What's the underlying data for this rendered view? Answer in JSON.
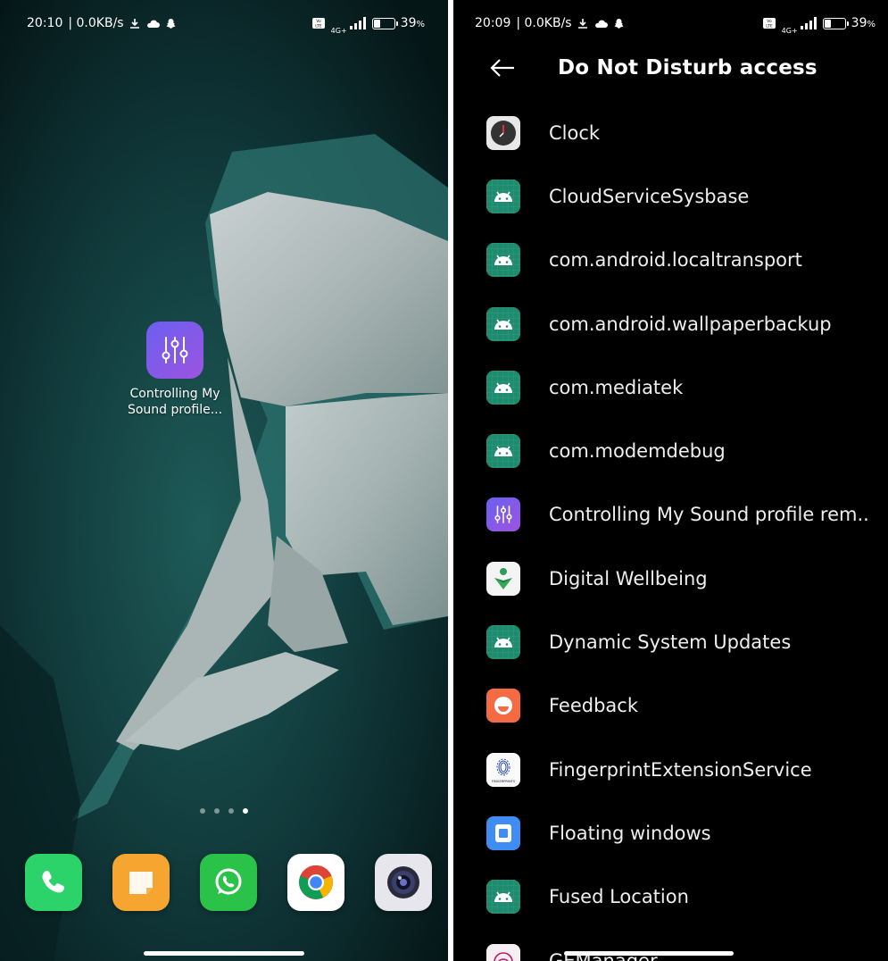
{
  "left_screen": {
    "status_bar": {
      "time": "20:10",
      "speed": "| 0.0KB/s",
      "network": "4G+",
      "battery": "39",
      "battery_unit": "%"
    },
    "home_app": {
      "label_line1": "Controlling My",
      "label_line2": "Sound profile...",
      "icon": "sliders-icon"
    },
    "page_indicator": {
      "pages": 4,
      "active": 4
    },
    "dock": [
      {
        "name": "phone",
        "icon": "phone-icon",
        "color": "#2bd36a"
      },
      {
        "name": "messages",
        "icon": "message-icon",
        "color": "#f7a531"
      },
      {
        "name": "whatsapp",
        "icon": "whatsapp-icon",
        "color": "#2bc24a"
      },
      {
        "name": "chrome",
        "icon": "chrome-icon",
        "color": "#ffffff"
      },
      {
        "name": "camera",
        "icon": "camera-icon",
        "color": "#e6e6ec"
      }
    ]
  },
  "right_screen": {
    "status_bar": {
      "time": "20:09",
      "speed": "| 0.0KB/s",
      "network": "4G+",
      "battery": "39",
      "battery_unit": "%"
    },
    "header": {
      "title": "Do Not Disturb access",
      "back_icon": "back-arrow-icon"
    },
    "apps": [
      {
        "label": "Clock",
        "icon": "clock-icon"
      },
      {
        "label": "CloudServiceSysbase",
        "icon": "android-icon"
      },
      {
        "label": "com.android.localtransport",
        "icon": "android-icon"
      },
      {
        "label": "com.android.wallpaperbackup",
        "icon": "android-icon"
      },
      {
        "label": "com.mediatek",
        "icon": "android-icon"
      },
      {
        "label": "com.modemdebug",
        "icon": "android-icon"
      },
      {
        "label": "Controlling My Sound profile rem..",
        "icon": "sliders-icon"
      },
      {
        "label": "Digital Wellbeing",
        "icon": "wellbeing-icon"
      },
      {
        "label": "Dynamic System Updates",
        "icon": "android-icon"
      },
      {
        "label": "Feedback",
        "icon": "feedback-icon"
      },
      {
        "label": "FingerprintExtensionService",
        "icon": "fingerprint-service-icon",
        "icon_text": "FINGERPRINTS"
      },
      {
        "label": "Floating windows",
        "icon": "floating-window-icon"
      },
      {
        "label": "Fused Location",
        "icon": "android-icon"
      },
      {
        "label": "GEManager",
        "icon": "fingerprint-icon"
      }
    ]
  },
  "colors": {
    "accent": "#7a5cf0",
    "android_green": "#1f8a6e",
    "background": "#000000"
  }
}
